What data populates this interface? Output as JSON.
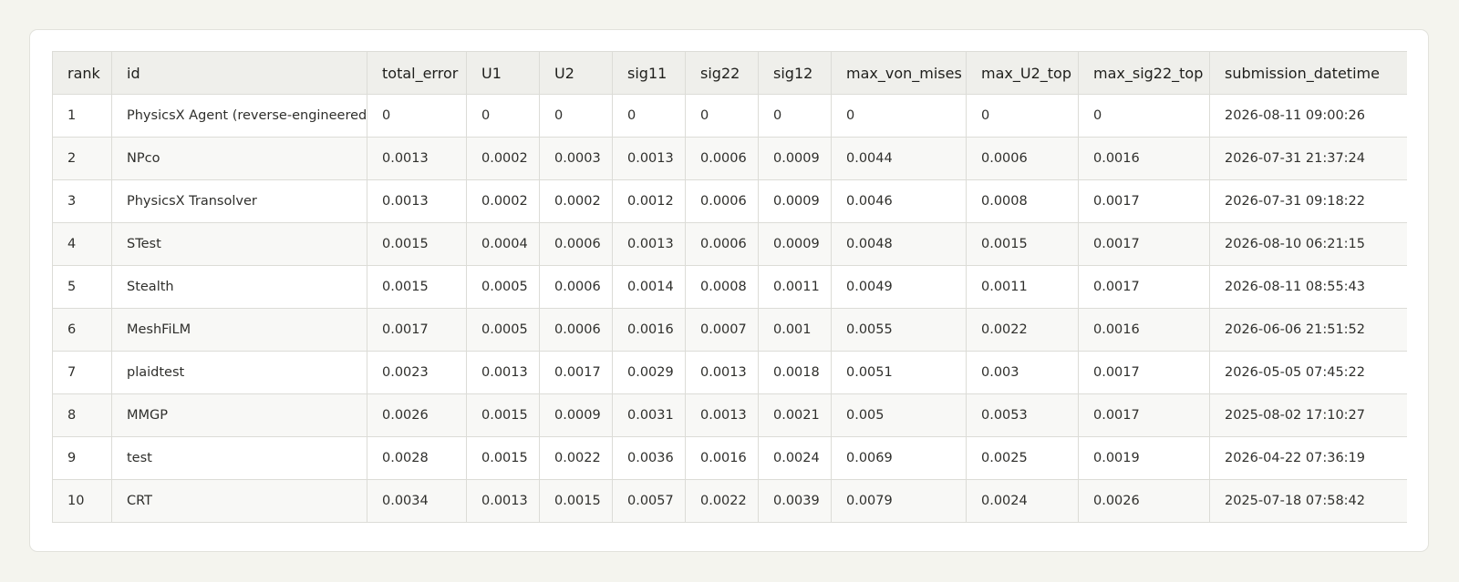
{
  "leaderboard": {
    "columns": [
      "rank",
      "id",
      "total_error",
      "U1",
      "U2",
      "sig11",
      "sig22",
      "sig12",
      "max_von_mises",
      "max_U2_top",
      "max_sig22_top",
      "submission_datetime"
    ],
    "rows": [
      [
        "1",
        "PhysicsX Agent (reverse-engineered)",
        "0",
        "0",
        "0",
        "0",
        "0",
        "0",
        "0",
        "0",
        "0",
        "2026-08-11 09:00:26"
      ],
      [
        "2",
        "NPco",
        "0.0013",
        "0.0002",
        "0.0003",
        "0.0013",
        "0.0006",
        "0.0009",
        "0.0044",
        "0.0006",
        "0.0016",
        "2026-07-31 21:37:24"
      ],
      [
        "3",
        "PhysicsX Transolver",
        "0.0013",
        "0.0002",
        "0.0002",
        "0.0012",
        "0.0006",
        "0.0009",
        "0.0046",
        "0.0008",
        "0.0017",
        "2026-07-31 09:18:22"
      ],
      [
        "4",
        "STest",
        "0.0015",
        "0.0004",
        "0.0006",
        "0.0013",
        "0.0006",
        "0.0009",
        "0.0048",
        "0.0015",
        "0.0017",
        "2026-08-10 06:21:15"
      ],
      [
        "5",
        "Stealth",
        "0.0015",
        "0.0005",
        "0.0006",
        "0.0014",
        "0.0008",
        "0.0011",
        "0.0049",
        "0.0011",
        "0.0017",
        "2026-08-11 08:55:43"
      ],
      [
        "6",
        "MeshFiLM",
        "0.0017",
        "0.0005",
        "0.0006",
        "0.0016",
        "0.0007",
        "0.001",
        "0.0055",
        "0.0022",
        "0.0016",
        "2026-06-06 21:51:52"
      ],
      [
        "7",
        "plaidtest",
        "0.0023",
        "0.0013",
        "0.0017",
        "0.0029",
        "0.0013",
        "0.0018",
        "0.0051",
        "0.003",
        "0.0017",
        "2026-05-05 07:45:22"
      ],
      [
        "8",
        "MMGP",
        "0.0026",
        "0.0015",
        "0.0009",
        "0.0031",
        "0.0013",
        "0.0021",
        "0.005",
        "0.0053",
        "0.0017",
        "2025-08-02 17:10:27"
      ],
      [
        "9",
        "test",
        "0.0028",
        "0.0015",
        "0.0022",
        "0.0036",
        "0.0016",
        "0.0024",
        "0.0069",
        "0.0025",
        "0.0019",
        "2026-04-22 07:36:19"
      ],
      [
        "10",
        "CRT",
        "0.0034",
        "0.0013",
        "0.0015",
        "0.0057",
        "0.0022",
        "0.0039",
        "0.0079",
        "0.0024",
        "0.0026",
        "2025-07-18 07:58:42"
      ]
    ]
  }
}
